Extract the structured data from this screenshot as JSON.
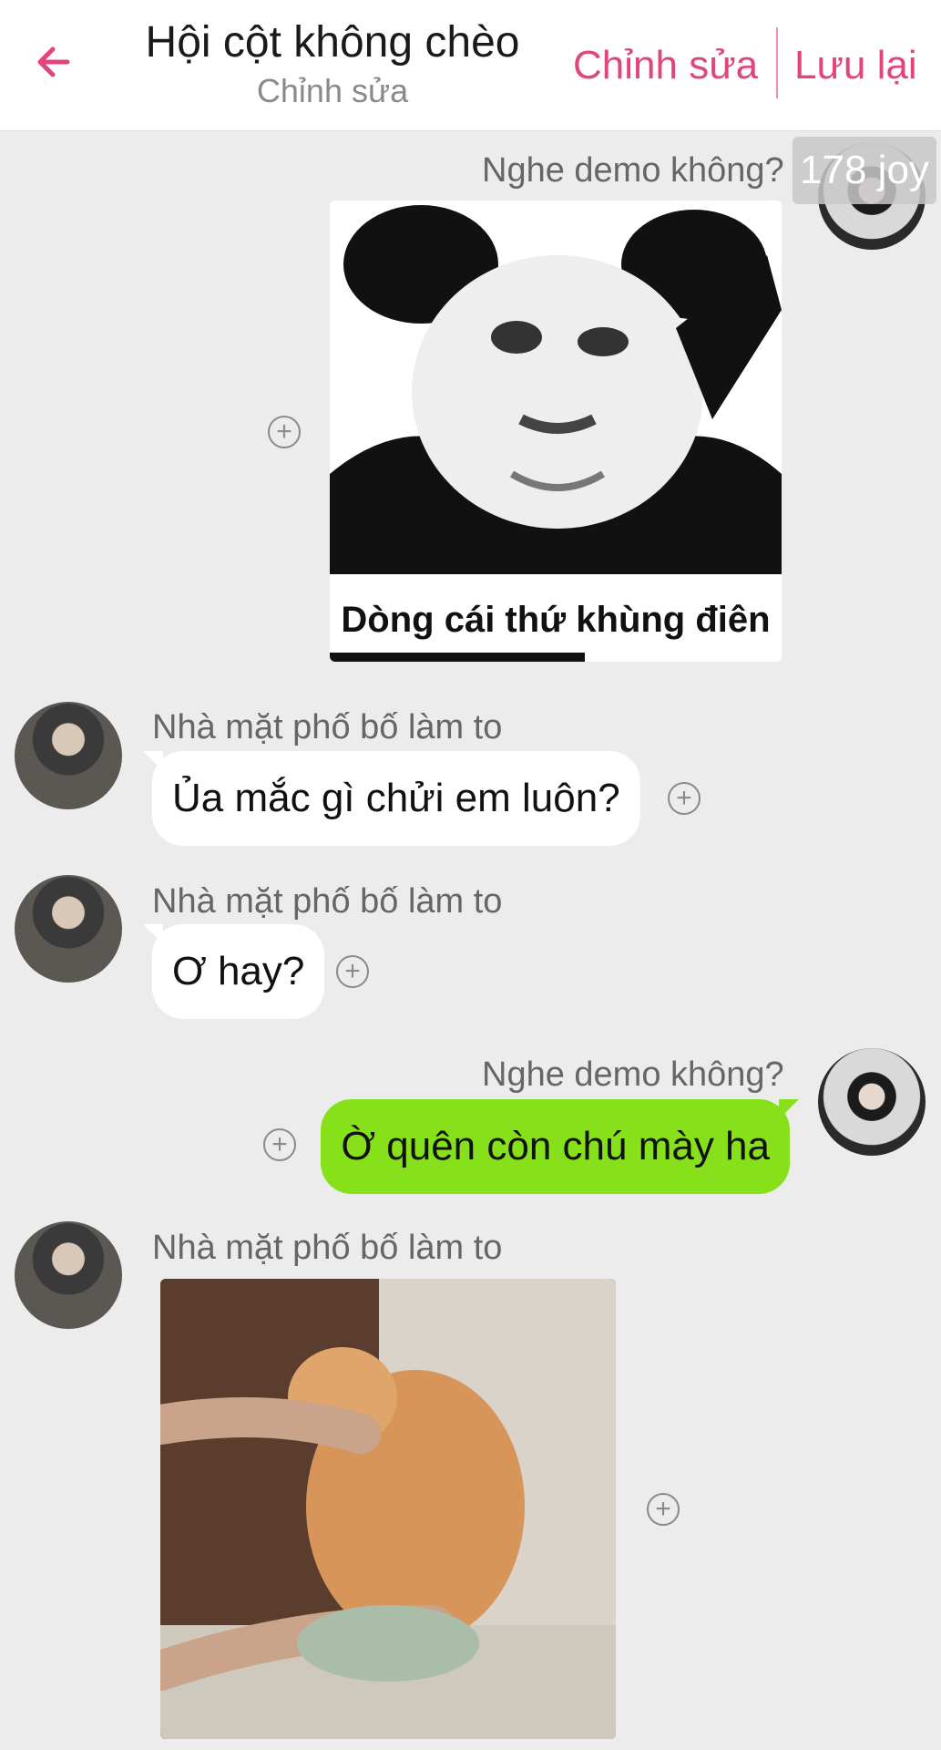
{
  "header": {
    "title": "Hội cột không chèo",
    "subtitle": "Chỉnh sửa",
    "edit_label": "Chỉnh sửa",
    "save_label": "Lưu lại",
    "accent_color": "#e0457e"
  },
  "badge": {
    "text": "178 joy"
  },
  "messages": [
    {
      "side": "right",
      "sender": "Nghe demo không?",
      "type": "sticker",
      "caption": "Dòng cái thứ khùng điên"
    },
    {
      "side": "left",
      "sender": "Nhà mặt phố bố làm to",
      "type": "text",
      "text": "Ủa mắc gì chửi em luôn?"
    },
    {
      "side": "left",
      "sender": "Nhà mặt phố bố làm to",
      "type": "text",
      "text": "Ơ hay?"
    },
    {
      "side": "right",
      "sender": "Nghe demo không?",
      "type": "text",
      "text": "Ờ quên còn chú mày ha"
    },
    {
      "side": "left",
      "sender": "Nhà mặt phố bố làm to",
      "type": "image"
    }
  ],
  "colors": {
    "outgoing_bubble": "#86e11b",
    "incoming_bubble": "#ffffff",
    "background": "#ececec"
  },
  "icons": {
    "back": "arrow-left-icon",
    "react": "plus-circle-icon"
  }
}
